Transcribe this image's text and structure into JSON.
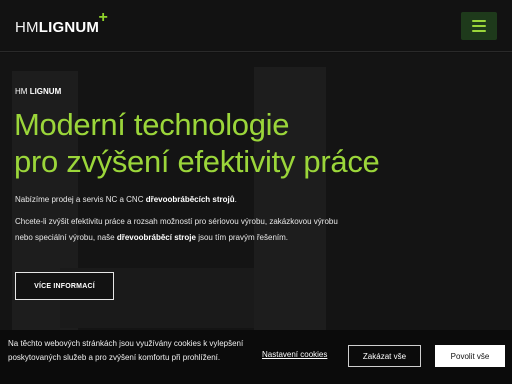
{
  "header": {
    "logo_light": "HM",
    "logo_bold": "LIGNUM",
    "logo_plus": "+"
  },
  "hero": {
    "kicker_light": "HM",
    "kicker_bold": "LIGNUM",
    "title_line1": "Moderní technologie",
    "title_line2": "pro zvýšení efektivity práce",
    "p1_text": "Nabízíme prodej a servis NC a CNC ",
    "p1_bold": "dřevoobráběcích strojů",
    "p1_end": ".",
    "p2_line1": "Chcete-li zvýšit efektivitu práce a rozsah možností pro sériovou výrobu, zakázkovou výrobu",
    "p2_line2_start": "nebo speciální výrobu, naše ",
    "p2_line2_bold": "dřevoobráběcí stroje",
    "p2_line2_end": " jsou tím pravým řešením.",
    "more_button": "VÍCE INFORMACÍ"
  },
  "cookie_bar": {
    "text": "Na těchto webových stránkách jsou využívány cookies k vylepšení poskytovaných služeb a pro zvýšení komfortu při prohlížení.",
    "settings_link": "Nastavení cookies",
    "reject_button": "Zakázat vše",
    "accept_button": "Povolit vše"
  },
  "colors": {
    "accent": "#9bd63a",
    "background": "#141414",
    "menu_button_bg": "#1e3a1b"
  },
  "icons": {
    "menu": "hamburger-menu-icon"
  }
}
